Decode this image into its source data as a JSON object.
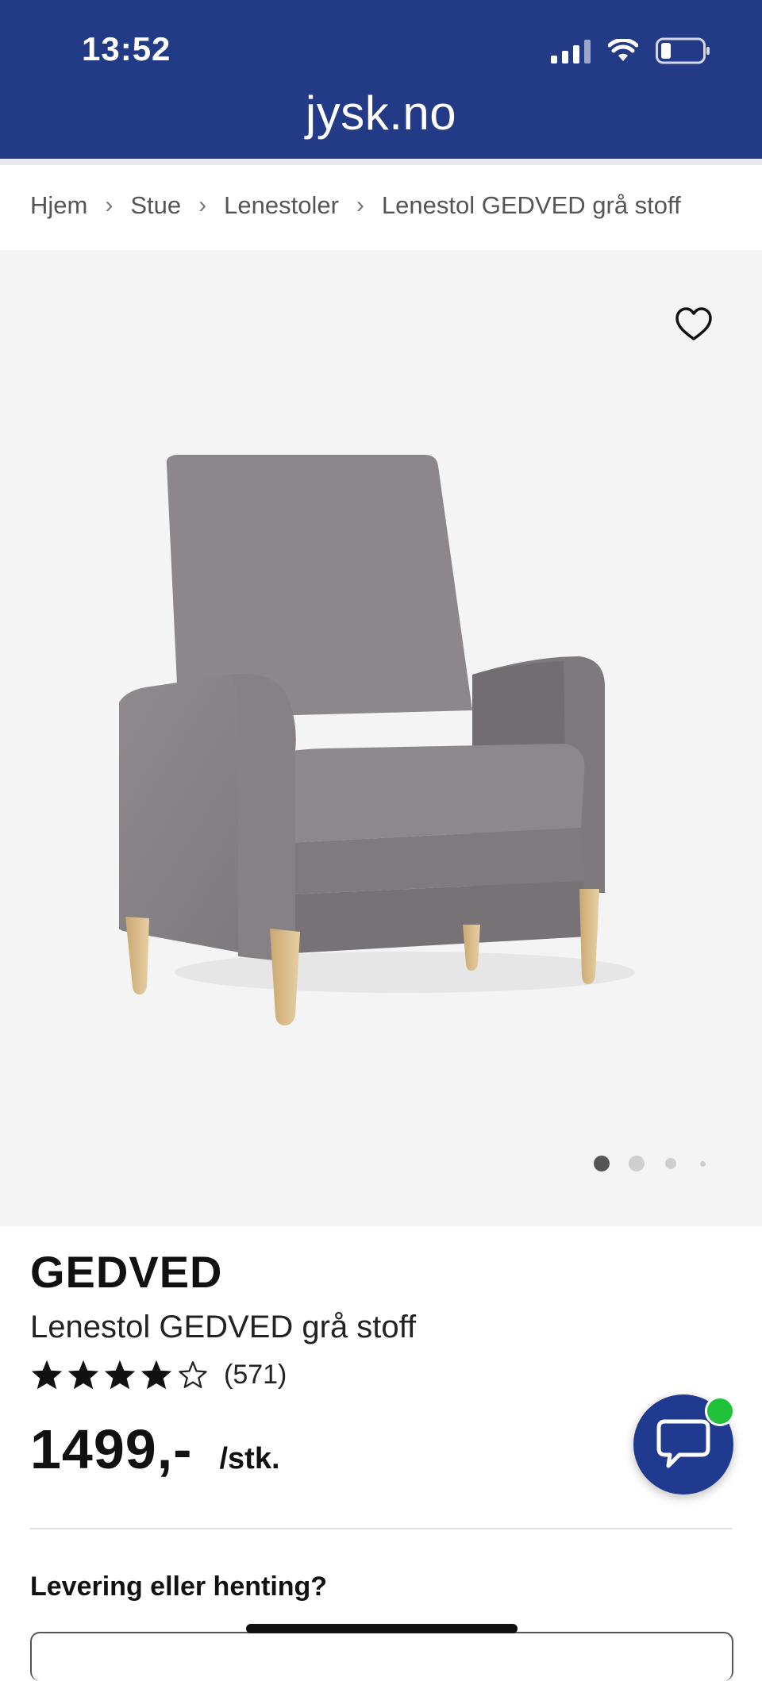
{
  "status_bar": {
    "time": "13:52",
    "icons": [
      "signal-icon",
      "wifi-icon",
      "battery-icon"
    ]
  },
  "browser": {
    "url": "jysk.no"
  },
  "breadcrumb": {
    "items": [
      "Hjem",
      "Stue",
      "Lenestoler",
      "Lenestol GEDVED grå stoff"
    ],
    "separator": "›"
  },
  "gallery": {
    "image_count": 4,
    "active_index": 0,
    "icons": [
      "heart-icon"
    ]
  },
  "product": {
    "brand": "GEDVED",
    "name": "Lenestol GEDVED grå stoff",
    "rating_stars": 4,
    "rating_max": 5,
    "review_count": "(571)",
    "price": "1499,-",
    "unit": "/stk."
  },
  "delivery": {
    "title": "Levering eller henting?"
  },
  "chat": {
    "icon": "chat-bubble-icon",
    "online": true
  },
  "colors": {
    "header_bg": "#233a86",
    "chat_bg": "#1f3a8e",
    "online_dot": "#1fc239",
    "gallery_bg": "#f4f4f4"
  }
}
